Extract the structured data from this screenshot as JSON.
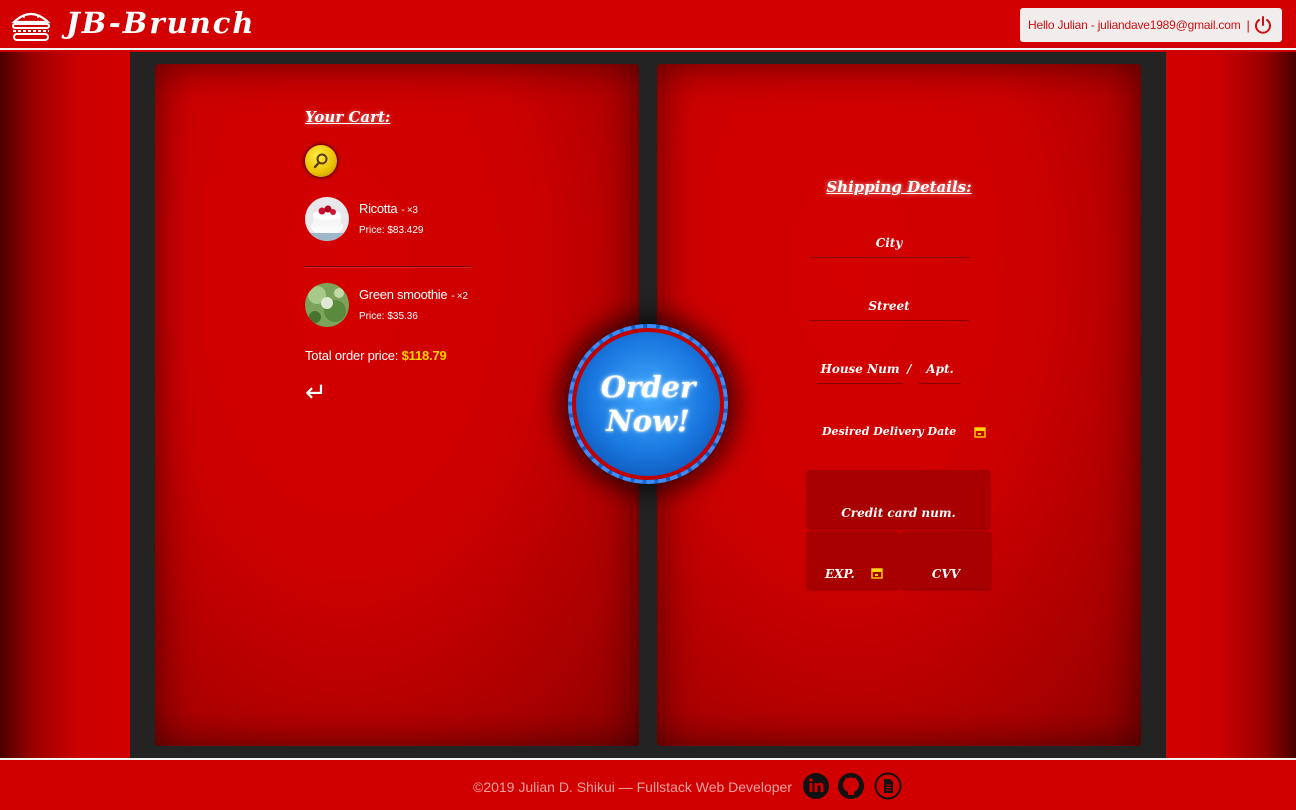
{
  "header": {
    "brand": "JB-Brunch",
    "user_greeting": "Hello Julian - juliandave1989@gmail.com",
    "separator": "|",
    "logo_icon": "burger-icon",
    "logout_icon": "power-icon"
  },
  "cart": {
    "title": "Your Cart:",
    "search_icon": "magnifier-icon",
    "items": [
      {
        "name": "Ricotta",
        "qty": "- ×3",
        "price": "Price: $83.429"
      },
      {
        "name": "Green smoothie",
        "qty": "- ×2",
        "price": "Price: $35.36"
      }
    ],
    "total_label": "Total order price:",
    "total_value": "$118.79",
    "back_symbol": "↵"
  },
  "order": {
    "line1": "Order",
    "line2": "Now!"
  },
  "shipping": {
    "title": "Shipping Details:",
    "city_placeholder": "City",
    "street_placeholder": "Street",
    "house_placeholder": "House Num",
    "slash": "/",
    "apt_placeholder": "Apt.",
    "date_placeholder": "Desired Delivery Date",
    "cc_num_placeholder": "Credit card num.",
    "exp_placeholder": "EXP.",
    "cvv_placeholder": "CVV"
  },
  "footer": {
    "text": "©2019 Julian D. Shikui — Fullstack Web Developer",
    "icons": [
      "linkedin-icon",
      "github-icon",
      "document-icon"
    ]
  },
  "colors": {
    "primary_red": "#cc0000",
    "frame_dark": "#232323",
    "accent_yellow": "#ffd400",
    "order_blue": "#1a78e0"
  }
}
